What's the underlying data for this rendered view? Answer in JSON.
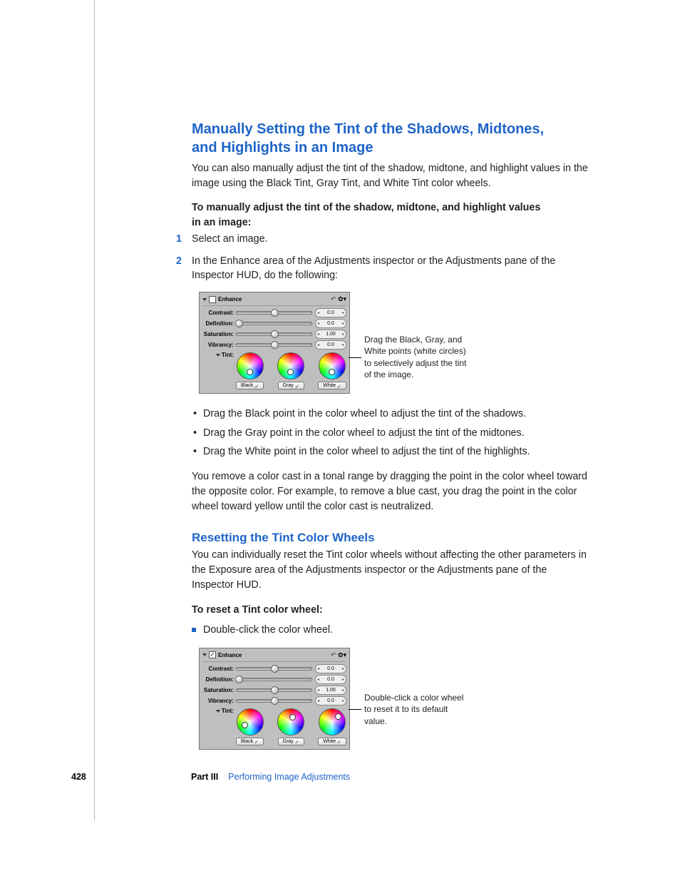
{
  "h1_line1": "Manually Setting the Tint of the Shadows, Midtones,",
  "h1_line2": "and Highlights in an Image",
  "intro": "You can also manually adjust the tint of the shadow, midtone, and highlight values in the image using the Black Tint, Gray Tint, and White Tint color wheels.",
  "task1_intro_l1": "To manually adjust the tint of the shadow, midtone, and highlight values",
  "task1_intro_l2": "in an image:",
  "steps": {
    "n1": "1",
    "s1": "Select an image.",
    "n2": "2",
    "s2": "In the Enhance area of the Adjustments inspector or the Adjustments pane of the Inspector HUD, do the following:"
  },
  "panel": {
    "title": "Enhance",
    "contrast_label": "Contrast:",
    "contrast_val": "0.0",
    "definition_label": "Definition:",
    "definition_val": "0.0",
    "saturation_label": "Saturation:",
    "saturation_val": "1.00",
    "vibrancy_label": "Vibrancy:",
    "vibrancy_val": "0.0",
    "tint_label": "Tint:",
    "black_btn": "Black",
    "gray_btn": "Gray",
    "white_btn": "White"
  },
  "callout1": "Drag the Black, Gray, and White points (white circles) to selectively adjust the tint of the image.",
  "sub_bullets": {
    "b1": "Drag the Black point in the color wheel to adjust the tint of the shadows.",
    "b2": "Drag the Gray point in the color wheel to adjust the tint of the midtones.",
    "b3": "Drag the White point in the color wheel to adjust the tint of the highlights."
  },
  "para_remove": "You remove a color cast in a tonal range by dragging the point in the color wheel toward the opposite color. For example, to remove a blue cast, you drag the point in the color wheel toward yellow until the color cast is neutralized.",
  "h2": "Resetting the Tint Color Wheels",
  "reset_intro": "You can individually reset the Tint color wheels without affecting the other parameters in the Exposure area of the Adjustments inspector or the Adjustments pane of the Inspector HUD.",
  "task2_intro": "To reset a Tint color wheel:",
  "task2_step": "Double-click the color wheel.",
  "callout2": "Double-click a color wheel to reset it to its default value.",
  "footer": {
    "page": "428",
    "part": "Part III",
    "chapter": "Performing Image Adjustments"
  }
}
